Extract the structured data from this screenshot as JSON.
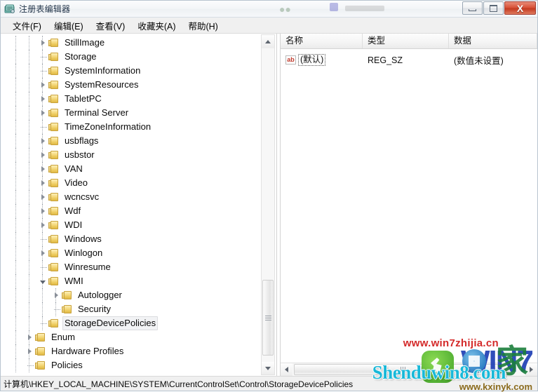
{
  "window": {
    "title": "注册表编辑器",
    "icon": "registry-editor-icon",
    "controls": {
      "minimize": "最小化",
      "maximize": "最大化",
      "close": "X"
    }
  },
  "menubar": {
    "items": [
      {
        "label": "文件(F)",
        "name": "menu-file"
      },
      {
        "label": "编辑(E)",
        "name": "menu-edit"
      },
      {
        "label": "查看(V)",
        "name": "menu-view"
      },
      {
        "label": "收藏夹(A)",
        "name": "menu-favorites"
      },
      {
        "label": "帮助(H)",
        "name": "menu-help"
      }
    ]
  },
  "tree": {
    "nodes": [
      {
        "label": "StillImage",
        "depth": 3,
        "state": "collapsed",
        "selected": false
      },
      {
        "label": "Storage",
        "depth": 3,
        "state": "leaf",
        "selected": false
      },
      {
        "label": "SystemInformation",
        "depth": 3,
        "state": "leaf",
        "selected": false
      },
      {
        "label": "SystemResources",
        "depth": 3,
        "state": "collapsed",
        "selected": false
      },
      {
        "label": "TabletPC",
        "depth": 3,
        "state": "collapsed",
        "selected": false
      },
      {
        "label": "Terminal Server",
        "depth": 3,
        "state": "collapsed",
        "selected": false
      },
      {
        "label": "TimeZoneInformation",
        "depth": 3,
        "state": "leaf",
        "selected": false
      },
      {
        "label": "usbflags",
        "depth": 3,
        "state": "collapsed",
        "selected": false
      },
      {
        "label": "usbstor",
        "depth": 3,
        "state": "collapsed",
        "selected": false
      },
      {
        "label": "VAN",
        "depth": 3,
        "state": "collapsed",
        "selected": false
      },
      {
        "label": "Video",
        "depth": 3,
        "state": "collapsed",
        "selected": false
      },
      {
        "label": "wcncsvc",
        "depth": 3,
        "state": "collapsed",
        "selected": false
      },
      {
        "label": "Wdf",
        "depth": 3,
        "state": "collapsed",
        "selected": false
      },
      {
        "label": "WDI",
        "depth": 3,
        "state": "collapsed",
        "selected": false
      },
      {
        "label": "Windows",
        "depth": 3,
        "state": "leaf",
        "selected": false
      },
      {
        "label": "Winlogon",
        "depth": 3,
        "state": "collapsed",
        "selected": false
      },
      {
        "label": "Winresume",
        "depth": 3,
        "state": "leaf",
        "selected": false
      },
      {
        "label": "WMI",
        "depth": 3,
        "state": "expanded",
        "selected": false
      },
      {
        "label": "Autologger",
        "depth": 4,
        "state": "collapsed",
        "selected": false
      },
      {
        "label": "Security",
        "depth": 4,
        "state": "leaf",
        "selected": false
      },
      {
        "label": "StorageDevicePolicies",
        "depth": 3,
        "state": "leaf",
        "selected": true
      },
      {
        "label": "Enum",
        "depth": 2,
        "state": "collapsed",
        "selected": false
      },
      {
        "label": "Hardware Profiles",
        "depth": 2,
        "state": "collapsed",
        "selected": false
      },
      {
        "label": "Policies",
        "depth": 2,
        "state": "leaf",
        "selected": false
      }
    ],
    "scrollbar": {
      "up_arrow": "▲",
      "down_arrow": "▼"
    }
  },
  "list": {
    "columns": [
      {
        "label": "名称",
        "name": "column-name"
      },
      {
        "label": "类型",
        "name": "column-type"
      },
      {
        "label": "数据",
        "name": "column-data"
      }
    ],
    "rows": [
      {
        "icon": "string-value-icon",
        "icon_text": "ab",
        "name": "(默认)",
        "type": "REG_SZ",
        "data": "(数值未设置)"
      }
    ],
    "scrollbar": {
      "left_arrow": "◄",
      "right_arrow": "►"
    }
  },
  "statusbar": {
    "path": "计算机\\HKEY_LOCAL_MACHINE\\SYSTEM\\CurrentControlSet\\Control\\StorageDevicePolicies"
  },
  "watermarks": {
    "win7zhijia": "www.win7zhijia.cn",
    "win7zhijia_logo": "WIN7",
    "jia": "家",
    "shenduwin8": "Shenduwin8.com",
    "kxinyk": "www.kxinyk.com"
  }
}
